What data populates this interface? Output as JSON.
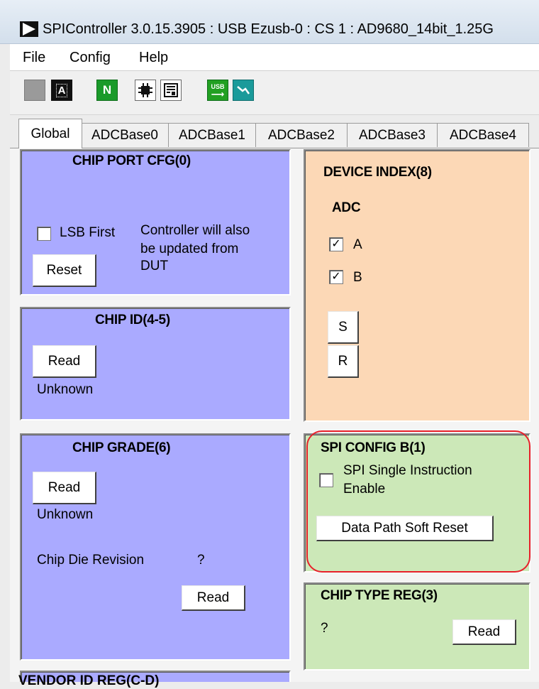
{
  "window": {
    "title": "SPIController 3.0.15.3905 : USB Ezusb-0 : CS 1 : AD9680_14bit_1.25G",
    "icon": "play-triangle-icon"
  },
  "menu": {
    "items": [
      "File",
      "Config",
      "Help"
    ]
  },
  "toolbar": {
    "buttons": [
      {
        "icon": "gray-square-icon"
      },
      {
        "icon": "analog-a-icon",
        "text": "A"
      },
      {
        "icon": "green-n-icon",
        "text": "N"
      },
      {
        "icon": "chip-icon"
      },
      {
        "icon": "register-map-icon"
      },
      {
        "icon": "usb-arrow-icon",
        "text": "USB"
      },
      {
        "icon": "probe-icon"
      }
    ]
  },
  "tabs": [
    "Global",
    "ADCBase0",
    "ADCBase1",
    "ADCBase2",
    "ADCBase3",
    "ADCBase4"
  ],
  "active_tab": "Global",
  "panels": {
    "chip_port_cfg": {
      "title": "CHIP PORT CFG(0)",
      "lsb_first_label": "LSB First",
      "lsb_first_checked": false,
      "note_line1": "Controller will also",
      "note_line2": "be updated from",
      "note_line3": "DUT",
      "reset_label": "Reset"
    },
    "chip_id": {
      "title": "CHIP ID(4-5)",
      "read_label": "Read",
      "value": "Unknown"
    },
    "chip_grade": {
      "title": "CHIP GRADE(6)",
      "read_label": "Read",
      "value": "Unknown",
      "die_revision_label": "Chip Die Revision",
      "die_revision_value": "?",
      "die_read_label": "Read"
    },
    "device_index": {
      "title": "DEVICE INDEX(8)",
      "subtitle": "ADC",
      "options": [
        {
          "label": "A",
          "checked": true
        },
        {
          "label": "B",
          "checked": true
        }
      ],
      "set_label": "S",
      "read_label": "R"
    },
    "spi_config_b": {
      "title": "SPI CONFIG B(1)",
      "single_instr_line1": "SPI Single Instruction",
      "single_instr_line2": "Enable",
      "single_instr_checked": false,
      "soft_reset_label": "Data Path Soft Reset"
    },
    "chip_type": {
      "title": "CHIP TYPE REG(3)",
      "value": "?",
      "read_label": "Read"
    },
    "vendor_id": {
      "title": "VENDOR ID REG(C-D)"
    }
  },
  "colors": {
    "blue_panel": "#aaaaff",
    "peach_panel": "#fcd8b6",
    "green_panel": "#cce8b8",
    "highlight_ring": "#e8202a"
  }
}
